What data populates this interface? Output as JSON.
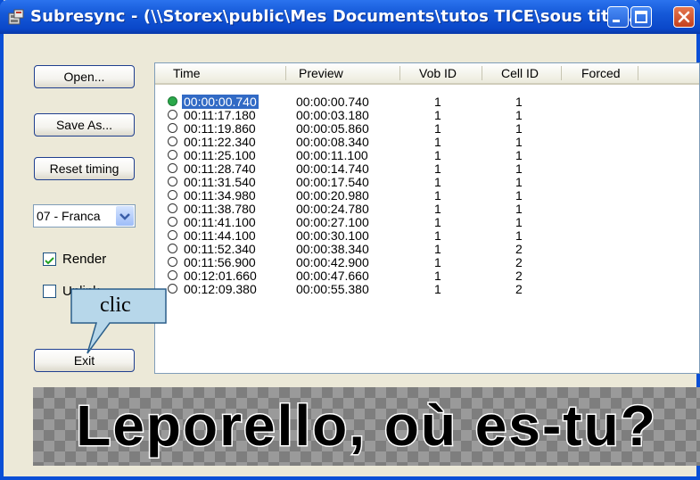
{
  "window": {
    "title": "Subresync - (\\\\Storex\\public\\Mes Documents\\tutos TICE\\sous titre...",
    "minimize_icon": "minimize-icon",
    "maximize_icon": "maximize-icon",
    "close_icon": "close-icon"
  },
  "buttons": {
    "open": "Open...",
    "save_as": "Save As...",
    "reset_timing": "Reset timing",
    "exit": "Exit"
  },
  "language_select": {
    "value": "07 - Franca"
  },
  "checkboxes": {
    "render": {
      "label": "Render",
      "checked": true
    },
    "unlink": {
      "label": "Unlink",
      "checked": false
    }
  },
  "table": {
    "columns": [
      "Time",
      "Preview",
      "Vob ID",
      "Cell ID",
      "Forced"
    ],
    "rows": [
      {
        "time": "00:00:00.740",
        "preview": "00:00:00.740",
        "vob_id": "1",
        "cell_id": "1",
        "selected": true
      },
      {
        "time": "00:11:17.180",
        "preview": "00:00:03.180",
        "vob_id": "1",
        "cell_id": "1"
      },
      {
        "time": "00:11:19.860",
        "preview": "00:00:05.860",
        "vob_id": "1",
        "cell_id": "1"
      },
      {
        "time": "00:11:22.340",
        "preview": "00:00:08.340",
        "vob_id": "1",
        "cell_id": "1"
      },
      {
        "time": "00:11:25.100",
        "preview": "00:00:11.100",
        "vob_id": "1",
        "cell_id": "1"
      },
      {
        "time": "00:11:28.740",
        "preview": "00:00:14.740",
        "vob_id": "1",
        "cell_id": "1"
      },
      {
        "time": "00:11:31.540",
        "preview": "00:00:17.540",
        "vob_id": "1",
        "cell_id": "1"
      },
      {
        "time": "00:11:34.980",
        "preview": "00:00:20.980",
        "vob_id": "1",
        "cell_id": "1"
      },
      {
        "time": "00:11:38.780",
        "preview": "00:00:24.780",
        "vob_id": "1",
        "cell_id": "1"
      },
      {
        "time": "00:11:41.100",
        "preview": "00:00:27.100",
        "vob_id": "1",
        "cell_id": "1"
      },
      {
        "time": "00:11:44.100",
        "preview": "00:00:30.100",
        "vob_id": "1",
        "cell_id": "1"
      },
      {
        "time": "00:11:52.340",
        "preview": "00:00:38.340",
        "vob_id": "1",
        "cell_id": "2"
      },
      {
        "time": "00:11:56.900",
        "preview": "00:00:42.900",
        "vob_id": "1",
        "cell_id": "2"
      },
      {
        "time": "00:12:01.660",
        "preview": "00:00:47.660",
        "vob_id": "1",
        "cell_id": "2"
      },
      {
        "time": "00:12:09.380",
        "preview": "00:00:55.380",
        "vob_id": "1",
        "cell_id": "2"
      }
    ]
  },
  "subtitle_preview": {
    "text": "Leporello, où es-tu?"
  },
  "callout": {
    "text": "clic"
  },
  "colors": {
    "titlebar": "#0a47c9",
    "selection": "#316ac5",
    "radio_active": "#2aa84a",
    "callout_fill": "#b7d7ea"
  }
}
